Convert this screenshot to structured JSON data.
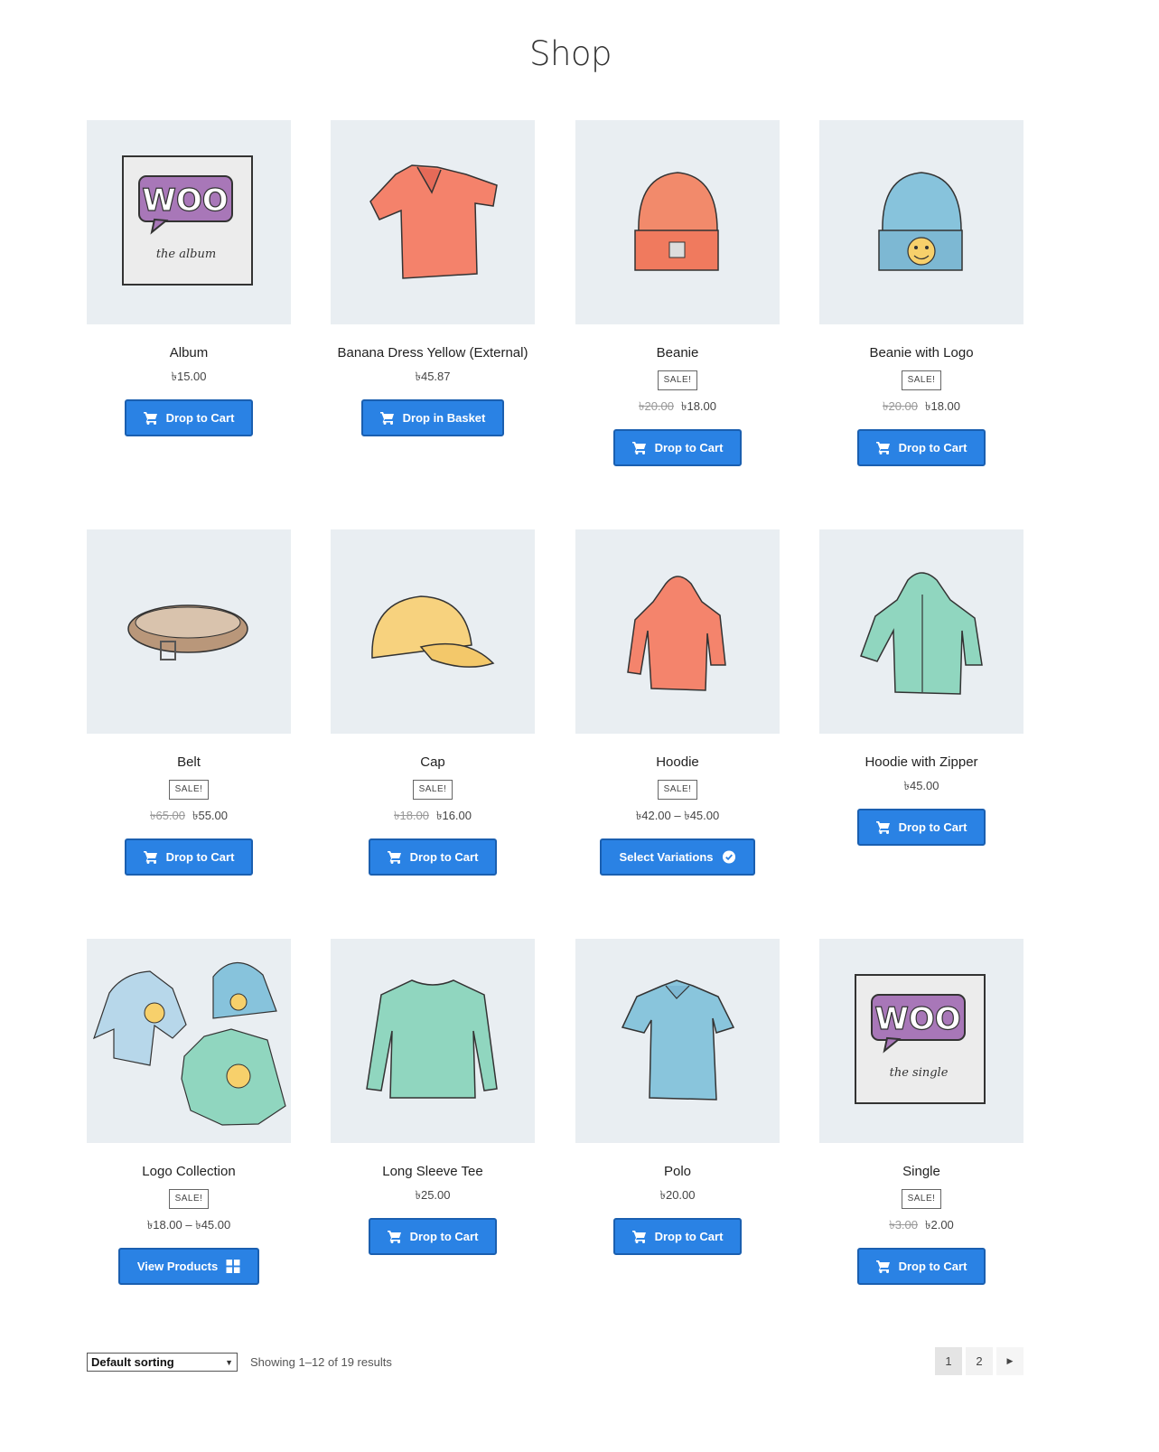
{
  "page": {
    "title": "Shop"
  },
  "products": [
    {
      "name": "Album",
      "price": "৳15.00",
      "button": "Drop to Cart"
    },
    {
      "name": "Banana Dress Yellow (External)",
      "price": "৳45.87",
      "button": "Drop in Basket"
    },
    {
      "name": "Beanie",
      "sale": "SALE!",
      "old_price": "৳20.00",
      "price": "৳18.00",
      "button": "Drop to Cart"
    },
    {
      "name": "Beanie with Logo",
      "sale": "SALE!",
      "old_price": "৳20.00",
      "price": "৳18.00",
      "button": "Drop to Cart"
    },
    {
      "name": "Belt",
      "sale": "SALE!",
      "old_price": "৳65.00",
      "price": "৳55.00",
      "button": "Drop to Cart"
    },
    {
      "name": "Cap",
      "sale": "SALE!",
      "old_price": "৳18.00",
      "price": "৳16.00",
      "button": "Drop to Cart"
    },
    {
      "name": "Hoodie",
      "sale": "SALE!",
      "price": "৳42.00 – ৳45.00",
      "button": "Select Variations"
    },
    {
      "name": "Hoodie with Zipper",
      "price": "৳45.00",
      "button": "Drop to Cart"
    },
    {
      "name": "Logo Collection",
      "sale": "SALE!",
      "price": "৳18.00 – ৳45.00",
      "button": "View Products"
    },
    {
      "name": "Long Sleeve Tee",
      "price": "৳25.00",
      "button": "Drop to Cart"
    },
    {
      "name": "Polo",
      "price": "৳20.00",
      "button": "Drop to Cart"
    },
    {
      "name": "Single",
      "sale": "SALE!",
      "old_price": "৳3.00",
      "price": "৳2.00",
      "button": "Drop to Cart"
    }
  ],
  "images": {
    "album_logo_text": "WOO",
    "album_caption": "the album",
    "single_logo_text": "WOO",
    "single_caption": "the single"
  },
  "footer": {
    "sort_selected": "Default sorting",
    "result_count": "Showing 1–12 of 19 results",
    "pages": [
      "1",
      "2"
    ],
    "current_page": "1"
  },
  "colors": {
    "button": "#2a82e4",
    "button_border": "#1a5fb0",
    "thumb_bg": "#e9eef2"
  }
}
